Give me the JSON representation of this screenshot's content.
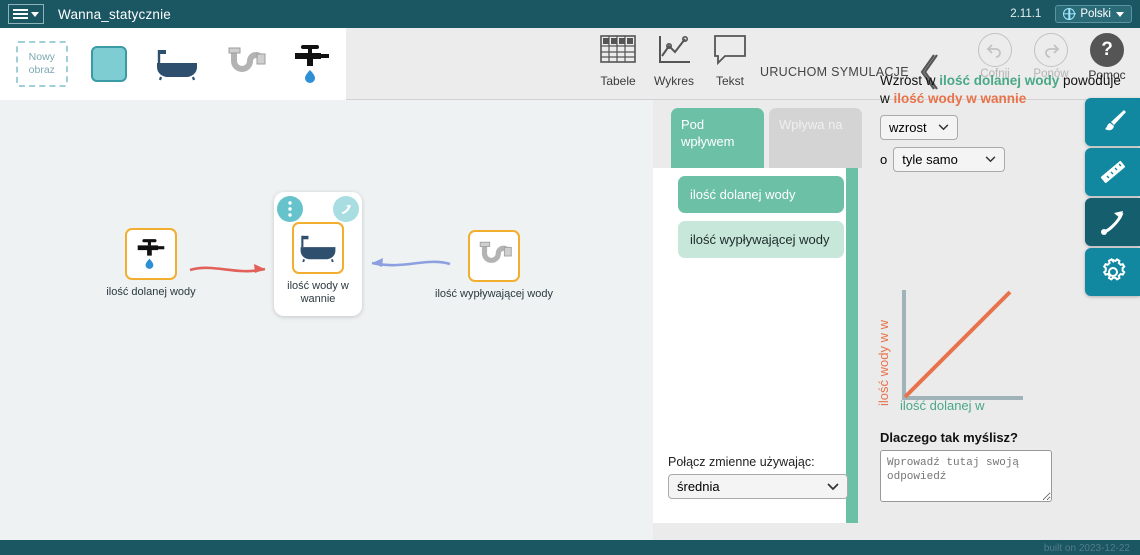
{
  "topbar": {
    "menu_icon": "hamburger-menu-icon",
    "project_title": "Wanna_statycznie",
    "version": "2.11.1",
    "language": "Polski",
    "globe_icon": "globe-icon"
  },
  "toolbar": {
    "new_image_label": "Nowy obraz",
    "palette_items": [
      "color-swatch",
      "bathtub-icon",
      "pipe-icon",
      "faucet-icon"
    ],
    "expand_icon": "chevron-down-icon",
    "tables_label": "Tabele",
    "chart_label": "Wykres",
    "text_label": "Tekst",
    "run_simulation_label": "URUCHOM SYMULACJĘ",
    "undo_label": "Cofnij",
    "redo_label": "Ponów",
    "help_label": "Pomoc",
    "help_glyph": "?"
  },
  "canvas": {
    "nodes": [
      {
        "label": "ilość dolanej wody",
        "icon": "faucet-icon"
      },
      {
        "label": "ilość wody w wannie",
        "icon": "bathtub-icon",
        "selected": true
      },
      {
        "label": "ilość wypływającej wody",
        "icon": "pipe-icon"
      }
    ],
    "node_menu_icon": "kebab-menu-icon",
    "node_link_icon": "arrow-link-icon"
  },
  "panel": {
    "tabs": [
      {
        "label": "Pod wpływem",
        "active": true
      },
      {
        "label": "Wpływa na",
        "active": false
      }
    ],
    "influencers": [
      {
        "label": "ilość dolanej wody",
        "selected": true
      },
      {
        "label": "ilość wypływającej wody",
        "selected": false
      }
    ],
    "combine_label": "Połącz zmienne używając:",
    "combine_value": "średnia"
  },
  "relation": {
    "prefix": "Wzrost w ",
    "source_var": "ilość dolanej wody",
    "middle": " powoduje w ",
    "target_var": "ilość wody w wannie",
    "effect_value": "wzrost",
    "by_label": "o",
    "amount_value": "tyle samo",
    "why_question": "Dlaczego tak myślisz?",
    "why_placeholder": "Wprowadź tutaj swoją odpowiedź"
  },
  "chart_data": {
    "type": "line",
    "title": "",
    "xlabel": "ilość dolanej w",
    "ylabel": "ilość wody w w",
    "x": [
      0,
      1
    ],
    "values": [
      0,
      1
    ],
    "xlim": [
      0,
      1
    ],
    "ylim": [
      0,
      1
    ],
    "grid": false,
    "legend": "none",
    "line_color": "#e8734a",
    "axis_color": "#9fb3b8",
    "xlabel_color": "#4aa886",
    "ylabel_color": "#e8734a"
  },
  "rail": {
    "items": [
      {
        "icon": "paintbrush-icon",
        "active": false
      },
      {
        "icon": "ruler-icon",
        "active": false
      },
      {
        "icon": "arrow-tool-icon",
        "active": true
      },
      {
        "icon": "gear-icon",
        "active": false
      }
    ]
  },
  "footer": {
    "built_on": "built on 2023-12-22"
  },
  "colors": {
    "header_bg": "#1b5663",
    "accent_green": "#6cc0a5",
    "accent_orange": "#e8734a",
    "node_border": "#f2ae2e",
    "rail_blue": "#1188a0"
  }
}
